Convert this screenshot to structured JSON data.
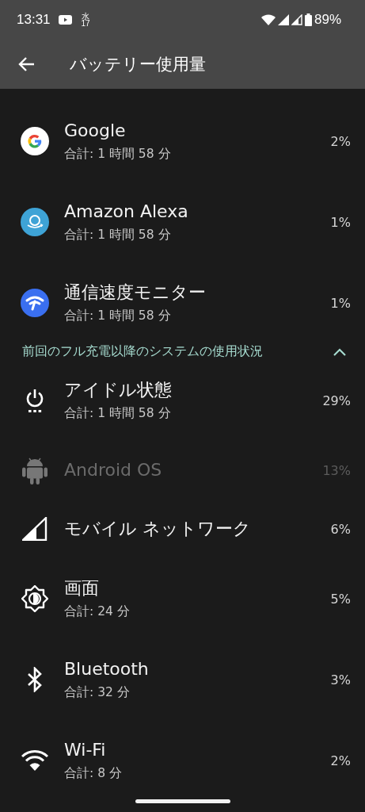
{
  "status_bar": {
    "time": "13:31",
    "calendar_day_label": "水",
    "calendar_date": "17",
    "battery": "89%"
  },
  "app_bar": {
    "title": "バッテリー使用量"
  },
  "apps": [
    {
      "name": "Google",
      "usage": "合計: 1 時間 58 分",
      "percent": "2%",
      "disabled": false
    },
    {
      "name": "Amazon Alexa",
      "usage": "合計: 1 時間 58 分",
      "percent": "1%",
      "disabled": false
    },
    {
      "name": "通信速度モニター",
      "usage": "合計: 1 時間 58 分",
      "percent": "1%",
      "disabled": false
    }
  ],
  "system_section": {
    "title": "前回のフル充電以降のシステムの使用状況",
    "expanded": true,
    "items": [
      {
        "name": "アイドル状態",
        "usage": "合計: 1 時間 58 分",
        "percent": "29%",
        "disabled": false
      },
      {
        "name": "Android OS",
        "percent": "13%",
        "disabled": true
      },
      {
        "name": "モバイル ネットワーク",
        "percent": "6%",
        "disabled": false
      },
      {
        "name": "画面",
        "usage": "合計: 24 分",
        "percent": "5%",
        "disabled": false
      },
      {
        "name": "Bluetooth",
        "usage": "合計: 32 分",
        "percent": "3%",
        "disabled": false
      },
      {
        "name": "Wi-Fi",
        "usage": "合計: 8 分",
        "percent": "2%",
        "disabled": false
      }
    ]
  }
}
